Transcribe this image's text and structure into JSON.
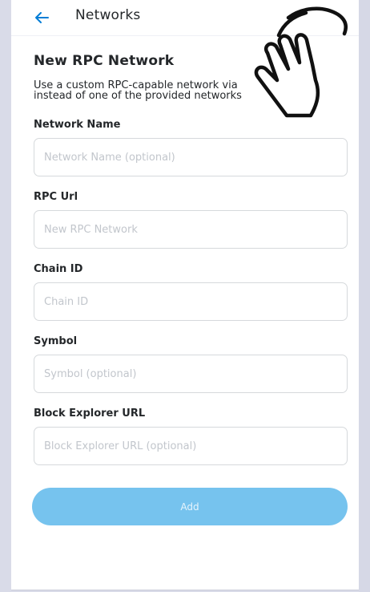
{
  "header": {
    "title": "Networks",
    "back_icon": "arrow-left-icon"
  },
  "form": {
    "title": "New RPC Network",
    "description_line1": "Use a custom RPC-capable network via",
    "description_line2": "instead of one of the provided networks",
    "fields": [
      {
        "label": "Network Name",
        "placeholder": "Network Name (optional)",
        "value": ""
      },
      {
        "label": "RPC Url",
        "placeholder": "New RPC Network",
        "value": ""
      },
      {
        "label": "Chain ID",
        "placeholder": "Chain ID",
        "value": ""
      },
      {
        "label": "Symbol",
        "placeholder": "Symbol (optional)",
        "value": ""
      },
      {
        "label": "Block Explorer URL",
        "placeholder": "Block Explorer URL (optional)",
        "value": ""
      }
    ],
    "add_label": "Add"
  },
  "overlay": {
    "pointer_icon": "pointing-hand-icon"
  },
  "colors": {
    "accent": "#037dd6",
    "button_disabled": "#76c3ee",
    "text": "#24272a",
    "placeholder": "#c2c6cc",
    "border": "#d6d9dc"
  }
}
